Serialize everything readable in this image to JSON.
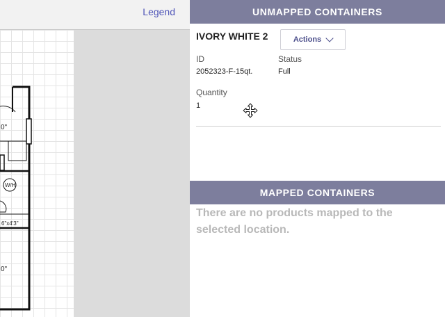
{
  "topbar": {
    "legend_label": "Legend"
  },
  "floorplan": {
    "labels": [
      "0\"",
      "W/H",
      "6\"x4'3\"",
      "0\""
    ]
  },
  "unmapped": {
    "header": "UNMAPPED CONTAINERS",
    "item": {
      "name": "IVORY WHITE 2",
      "actions_label": "Actions",
      "id_label": "ID",
      "id_value": "2052323-F-15qt.",
      "status_label": "Status",
      "status_value": "Full",
      "quantity_label": "Quantity",
      "quantity_value": "1"
    }
  },
  "mapped": {
    "header": "MAPPED CONTAINERS",
    "empty_message": "There are no products mapped to the selected location."
  },
  "colors": {
    "header_bg": "#7d7e9d",
    "link": "#4f55b8",
    "muted_text": "#b8b8b8"
  },
  "icons": {
    "move": "move-cursor-icon",
    "chevron": "chevron-down-icon"
  }
}
